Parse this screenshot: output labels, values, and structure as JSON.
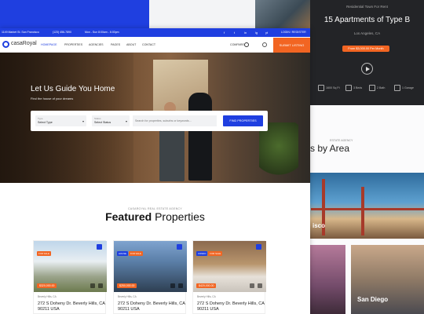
{
  "right_panel": {
    "eyebrow": "Residential Town For Rent",
    "title": "15 Apartments of Type B",
    "location": "Los Angeles, CA",
    "price_button": "From $3,000.00 Per Month",
    "features": [
      "1600 Sq Ft",
      "3 Beds",
      "2 Bath",
      "1 Garage"
    ],
    "area_eyebrow": "ESTATE AGENCY",
    "area_title": "s by Area",
    "city_1": "isco",
    "city_2": "San Diego"
  },
  "topbar": {
    "address": "1149 Market St. San Francisco",
    "phone": "(123) 456-7890",
    "hours": "Mon - Sun 8:00am - 6:00pm",
    "social": [
      "f",
      "t",
      "in",
      "ig",
      "yt"
    ],
    "login": "LOGIN / REGISTER"
  },
  "nav": {
    "logo": "casaRoyal",
    "items": [
      "HOMEPAGE",
      "PROPERTIES",
      "AGENCIES",
      "PAGES",
      "ABOUT",
      "CONTACT"
    ],
    "compare": "COMPARE",
    "submit": "SUBMIT LISTING"
  },
  "hero": {
    "title": "Let Us Guide You Home",
    "subtitle": "Find the house of your dreams",
    "type_label": "Type",
    "type_value": "Select Type",
    "status_label": "Status",
    "status_value": "Select Status",
    "search_placeholder": "Search for properties, suburbs or keywords...",
    "find_button": "FIND PROPERTIES"
  },
  "featured": {
    "eyebrow": "CASAROYAL REAL ESTATE AGENCY",
    "title_bold": "Featured",
    "title_light": " Properties"
  },
  "cards": [
    {
      "tags": [
        "FOR SALE"
      ],
      "price": "$320,000.00",
      "location": "Beverly Hills, CA",
      "address": "272 S Doheny Dr. Beverly Hills, CA 90211 USA"
    },
    {
      "tags": [
        "HOUSE",
        "FOR SALE"
      ],
      "price": "$250,000.00",
      "location": "Beverly Hills, CA",
      "address": "272 S Doheny Dr. Beverly Hills, CA 90211 USA"
    },
    {
      "tags": [
        "CONDO",
        "FOR SALE"
      ],
      "price": "$420,000.00",
      "location": "Beverly Hills, CA",
      "address": "272 S Doheny Dr. Beverly Hills, CA 90211 USA"
    }
  ],
  "colors": {
    "brand_blue": "#1f3fe0",
    "accent_orange": "#f26522",
    "dark_panel": "#232427"
  }
}
